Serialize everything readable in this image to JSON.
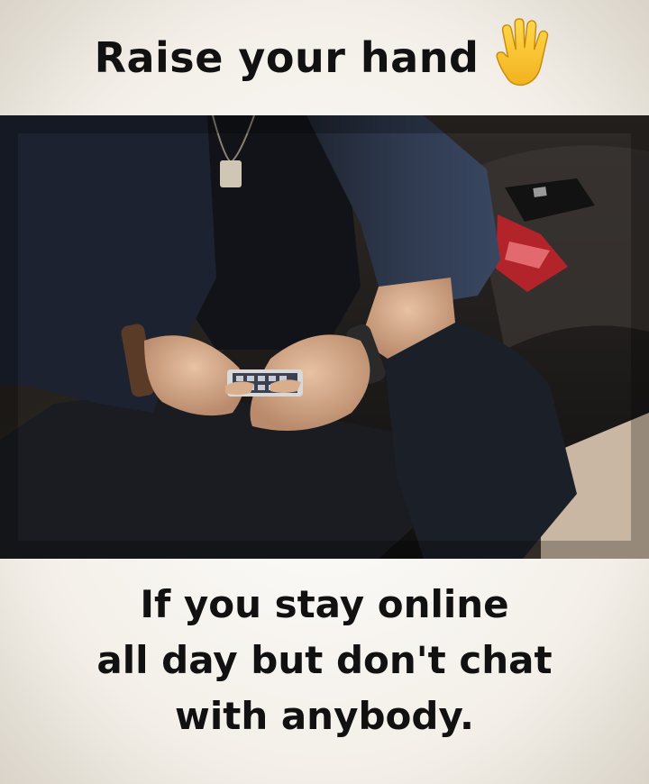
{
  "header": {
    "title": "Raise your hand",
    "icon": "raised-hand-icon"
  },
  "photo": {
    "subject": "person-using-phone-image"
  },
  "caption": {
    "lines": [
      "If you stay online",
      "all day but don't chat",
      "with anybody."
    ]
  },
  "colors": {
    "text": "#111111",
    "background": "#f3efe8",
    "hand": "#f6c432"
  }
}
